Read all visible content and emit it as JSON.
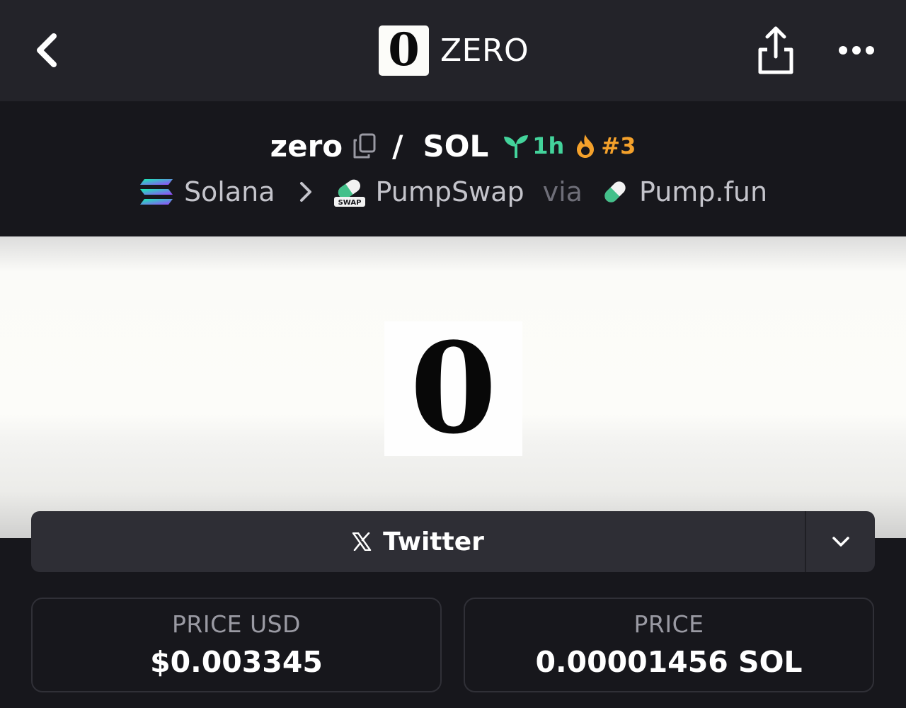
{
  "header": {
    "brand_logo_glyph": "0",
    "brand_name": "ZERO",
    "back_icon": "chevron-left-icon",
    "share_icon": "share-icon",
    "more_icon": "more-horizontal-icon"
  },
  "pair": {
    "base": "zero",
    "separator": "/",
    "quote": "SOL",
    "age": "1h",
    "age_icon": "sprout-icon",
    "age_color": "#43d39b",
    "rank": "#3",
    "rank_icon": "flame-icon",
    "rank_color": "#f4a12b"
  },
  "chain": {
    "network": "Solana",
    "dex": "PumpSwap",
    "dex_badge": "SWAP",
    "via": "via",
    "launchpad": "Pump.fun"
  },
  "banner": {
    "logo_glyph": "0"
  },
  "social": {
    "label": "Twitter",
    "icon": "x-logo-icon"
  },
  "stats": {
    "price_usd_label": "PRICE USD",
    "price_usd_value": "$0.003345",
    "price_label": "PRICE",
    "price_value": "0.00001456 SOL"
  }
}
